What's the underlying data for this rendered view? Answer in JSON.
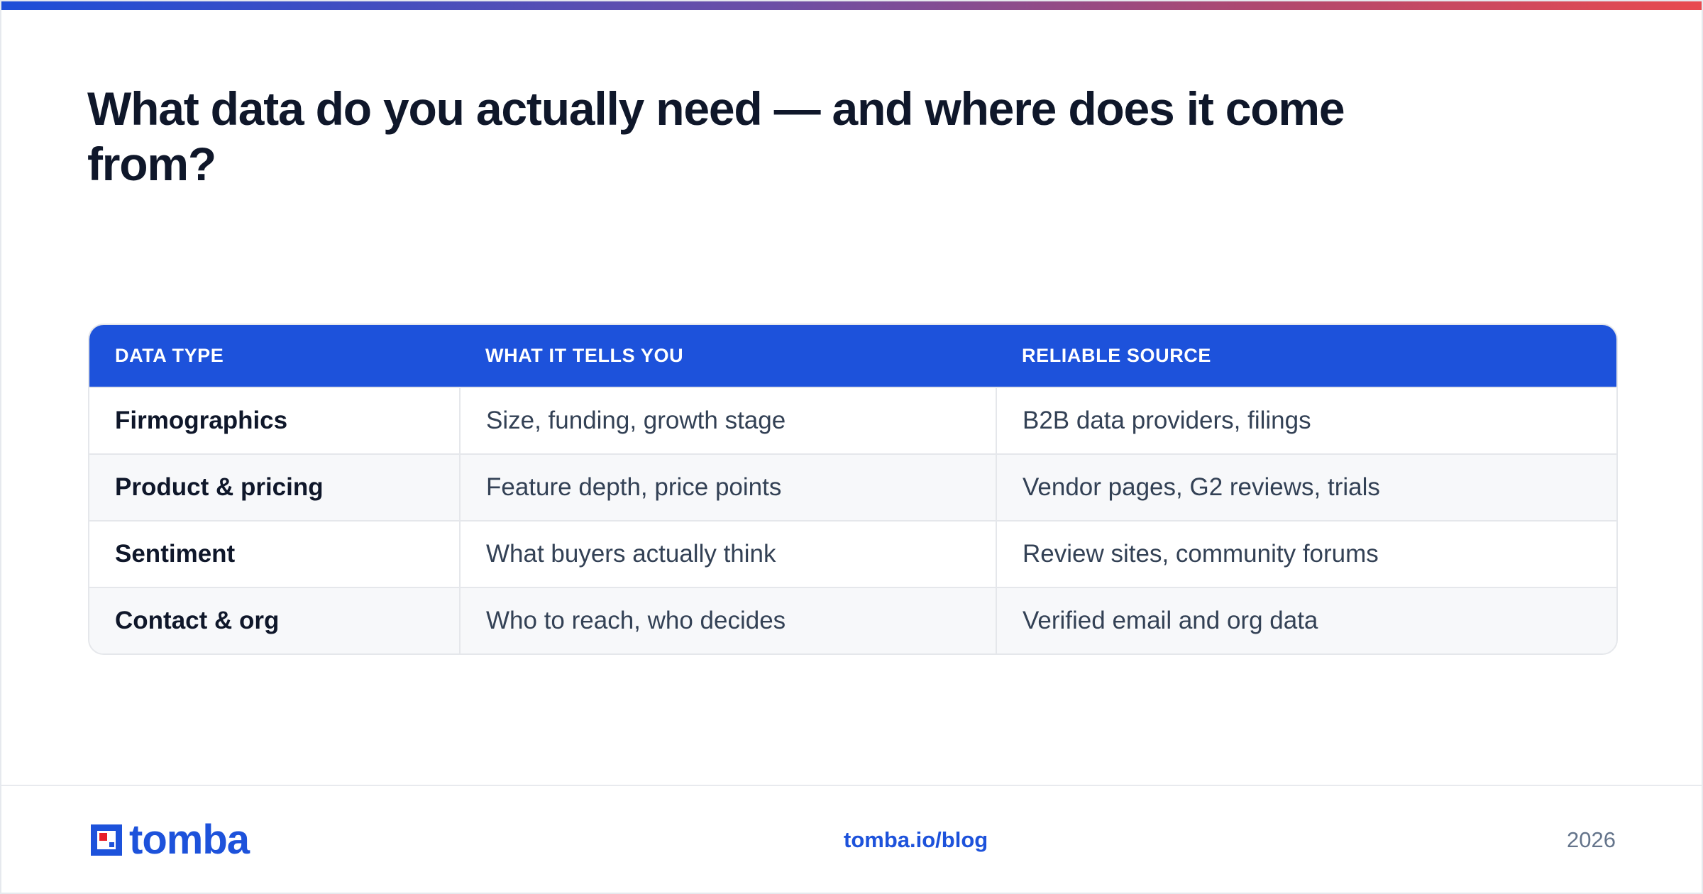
{
  "title": "What data do you actually need — and where does it come from?",
  "table": {
    "headers": [
      "DATA TYPE",
      "WHAT IT TELLS YOU",
      "RELIABLE SOURCE"
    ],
    "rows": [
      {
        "type": "Firmographics",
        "tells": "Size, funding, growth stage",
        "source": "B2B data providers, filings"
      },
      {
        "type": "Product & pricing",
        "tells": "Feature depth, price points",
        "source": "Vendor pages, G2 reviews, trials"
      },
      {
        "type": "Sentiment",
        "tells": "What buyers actually think",
        "source": "Review sites, community forums"
      },
      {
        "type": "Contact & org",
        "tells": "Who to reach, who decides",
        "source": "Verified email and org data"
      }
    ]
  },
  "footer": {
    "logo_text": "tomba",
    "link": "tomba.io/blog",
    "year": "2026"
  },
  "colors": {
    "brand": "#1d52db",
    "accent_red": "#e8202a",
    "heading": "#0f172a",
    "body_text": "#334155"
  }
}
